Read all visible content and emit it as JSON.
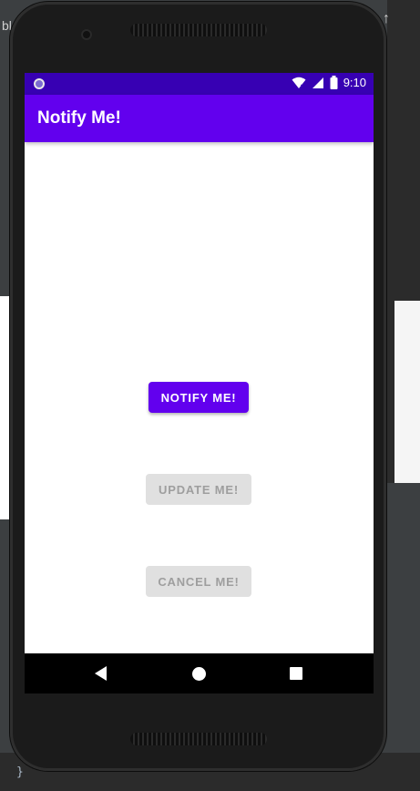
{
  "ide": {
    "left_tab_fragment": "ble",
    "closing_brace": "}"
  },
  "status_bar": {
    "time": "9:10",
    "icons": [
      "notification-dot-icon",
      "wifi-icon",
      "signal-icon",
      "battery-icon"
    ]
  },
  "app_bar": {
    "title": "Notify Me!"
  },
  "buttons": {
    "notify": "NOTIFY ME!",
    "update": "UPDATE ME!",
    "cancel": "CANCEL ME!"
  },
  "nav_bar": {
    "icons": [
      "back-icon",
      "home-icon",
      "recents-icon"
    ]
  },
  "colors": {
    "primary": "#6200ee",
    "primary_dark": "#3700b3",
    "disabled_button": "#e0e0e0"
  }
}
